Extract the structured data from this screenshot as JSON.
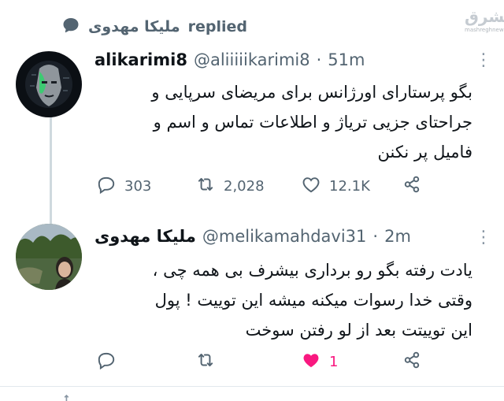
{
  "context": {
    "replier": "ملیکا مهدوی",
    "action": "replied"
  },
  "watermark": {
    "line1": "مشرق",
    "line2": "mashreghnews.ir"
  },
  "tweets": [
    {
      "display_name": "alikarimi8",
      "handle": "@aliiiiikarimi8",
      "dot": "·",
      "time": "51m",
      "more": "⋮",
      "lines": [
        "بگو پرستارای اورژانس برای مریضای سرپایی و",
        "جراحتای جزیی تریاژ و اطلاعات تماس و اسم و",
        "فامیل پر نکنن"
      ],
      "reply_count": "303",
      "retweet_count": "2,028",
      "like_count": "12.1K"
    },
    {
      "display_name": "ملیکا مهدوی",
      "handle": "@melikamahdavi31",
      "dot": "·",
      "time": "2m",
      "more": "⋮",
      "lines": [
        "یادت رفته بگو رو برداری بیشرف بی همه چی ،",
        "وقتی خدا رسوات میکنه میشه این توییت ! پول",
        "این توییتت بعد از لو رفتن سوخت"
      ],
      "reply_count": "",
      "retweet_count": "",
      "like_count": "1",
      "liked": true
    }
  ],
  "colors": {
    "like_active": "#f91880",
    "muted": "#536471"
  }
}
